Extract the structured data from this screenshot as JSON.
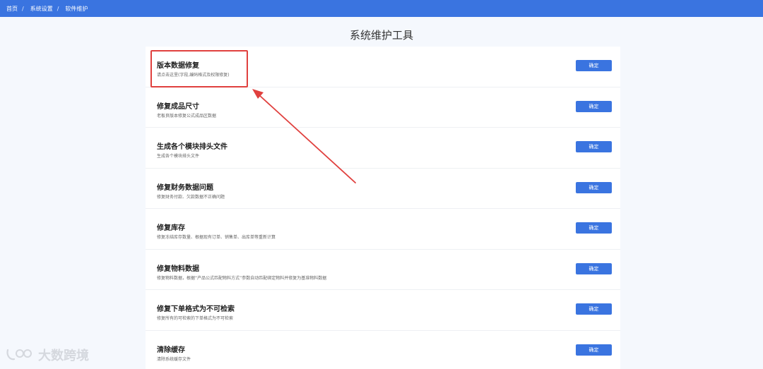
{
  "breadcrumb": {
    "items": [
      "首页",
      "系统设置",
      "软件维护"
    ],
    "separator": "/"
  },
  "page_title": "系统维护工具",
  "tools": [
    {
      "name": "版本数据修复",
      "desc": "请点击这里(字段,编码格式及权限修复)",
      "button": "确定"
    },
    {
      "name": "修复成品尺寸",
      "desc": "老板良版本修复公式成品区数据",
      "button": "确定"
    },
    {
      "name": "生成各个模块排头文件",
      "desc": "生成各个模块排头文件",
      "button": "确定"
    },
    {
      "name": "修复财务数据问题",
      "desc": "修复财务付款、欠款数据不正确问题",
      "button": "确定"
    },
    {
      "name": "修复库存",
      "desc": "修复冻结库存数量、根据现有订单、销售单、出库单等重新计算",
      "button": "确定"
    },
    {
      "name": "修复物料数据",
      "desc": "修复物料数据，根据“产品公式匹配物料方式”参数自动匹配绑定物料并修复为基准物料数据",
      "button": "确定"
    },
    {
      "name": "修复下单格式为不可检索",
      "desc": "修复所有的可检索的下单格式为不可检索",
      "button": "确定"
    },
    {
      "name": "清除缓存",
      "desc": "清除系统缓存文件",
      "button": "确定"
    }
  ],
  "watermark": "大数跨境",
  "colors": {
    "accent": "#3a74e0",
    "annotation": "#e0403e",
    "background": "#f5f8fd"
  }
}
